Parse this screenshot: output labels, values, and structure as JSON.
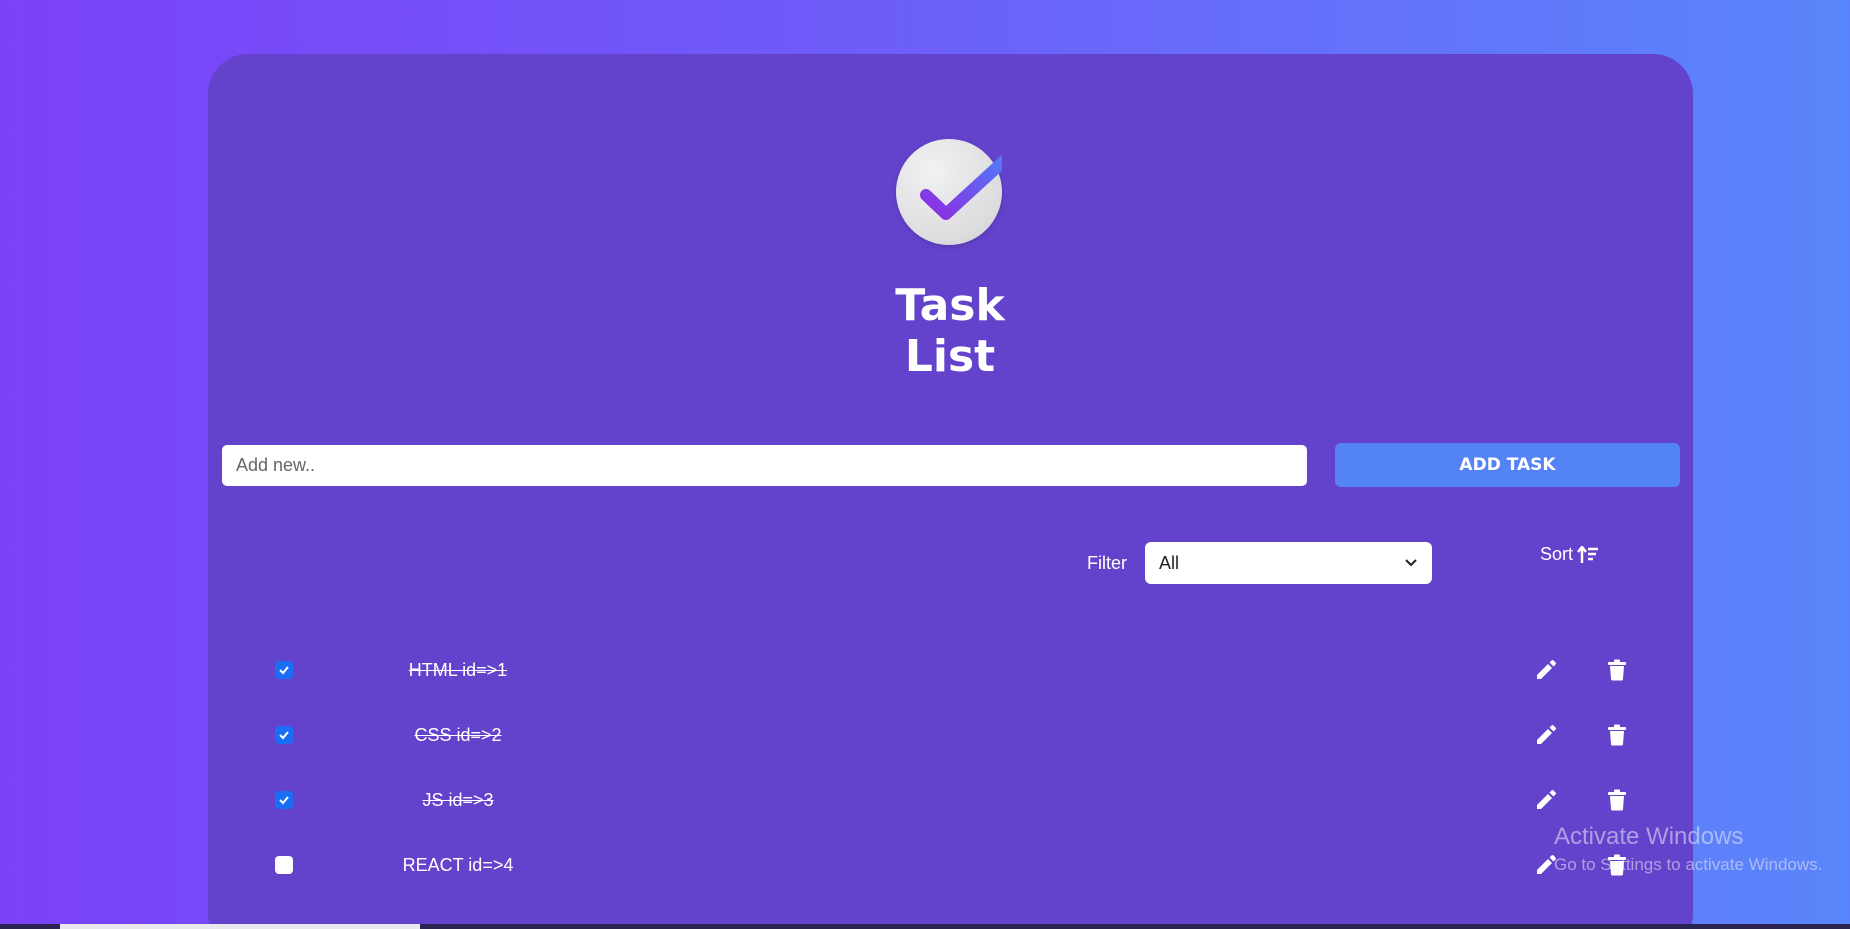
{
  "app": {
    "title": "Task List",
    "logo_icon": "check-circle-icon"
  },
  "new_task": {
    "placeholder": "Add new..",
    "value": "",
    "add_button_label": "ADD TASK"
  },
  "filter": {
    "label": "Filter",
    "selected": "All"
  },
  "sort": {
    "label": "Sort",
    "icon": "sort-ascending-icon"
  },
  "tasks": [
    {
      "text": "HTML id=>1",
      "done": true
    },
    {
      "text": "CSS id=>2",
      "done": true
    },
    {
      "text": "JS id=>3",
      "done": true
    },
    {
      "text": "REACT id=>4",
      "done": false
    }
  ],
  "watermark": {
    "line1": "Activate Windows",
    "line2": "Go to Settings to activate Windows."
  },
  "colors": {
    "card": "#6343cc",
    "accent_button": "#5483f6",
    "checkbox_checked": "#1a6ef5"
  }
}
